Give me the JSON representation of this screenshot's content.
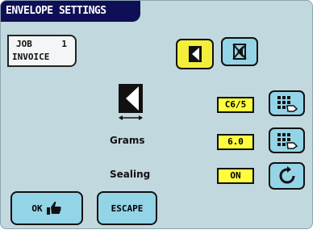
{
  "title": "ENVELOPE SETTINGS",
  "job": {
    "line1": "JOB",
    "number": "1",
    "line2": "INVOICE"
  },
  "mode_buttons": [
    {
      "icon": "envelope-flap-icon",
      "selected": true
    },
    {
      "icon": "envelope-crossed-icon",
      "selected": false
    }
  ],
  "envelope": {
    "icon": "envelope-size-icon",
    "value": "C6/5",
    "edit_icon": "keypad-icon"
  },
  "grams": {
    "label": "Grams",
    "value": "6.0",
    "edit_icon": "keypad-icon"
  },
  "sealing": {
    "label": "Sealing",
    "value": "ON",
    "toggle_icon": "cycle-icon"
  },
  "ok_button": {
    "label": "OK",
    "icon": "thumbs-up-icon"
  },
  "escape_button": {
    "label": "ESCAPE"
  },
  "colors": {
    "title_bg": "#0f0f57",
    "panel_bg": "#c2d8df",
    "yellow": "#f2ee3b",
    "cyan": "#94d4e7"
  }
}
